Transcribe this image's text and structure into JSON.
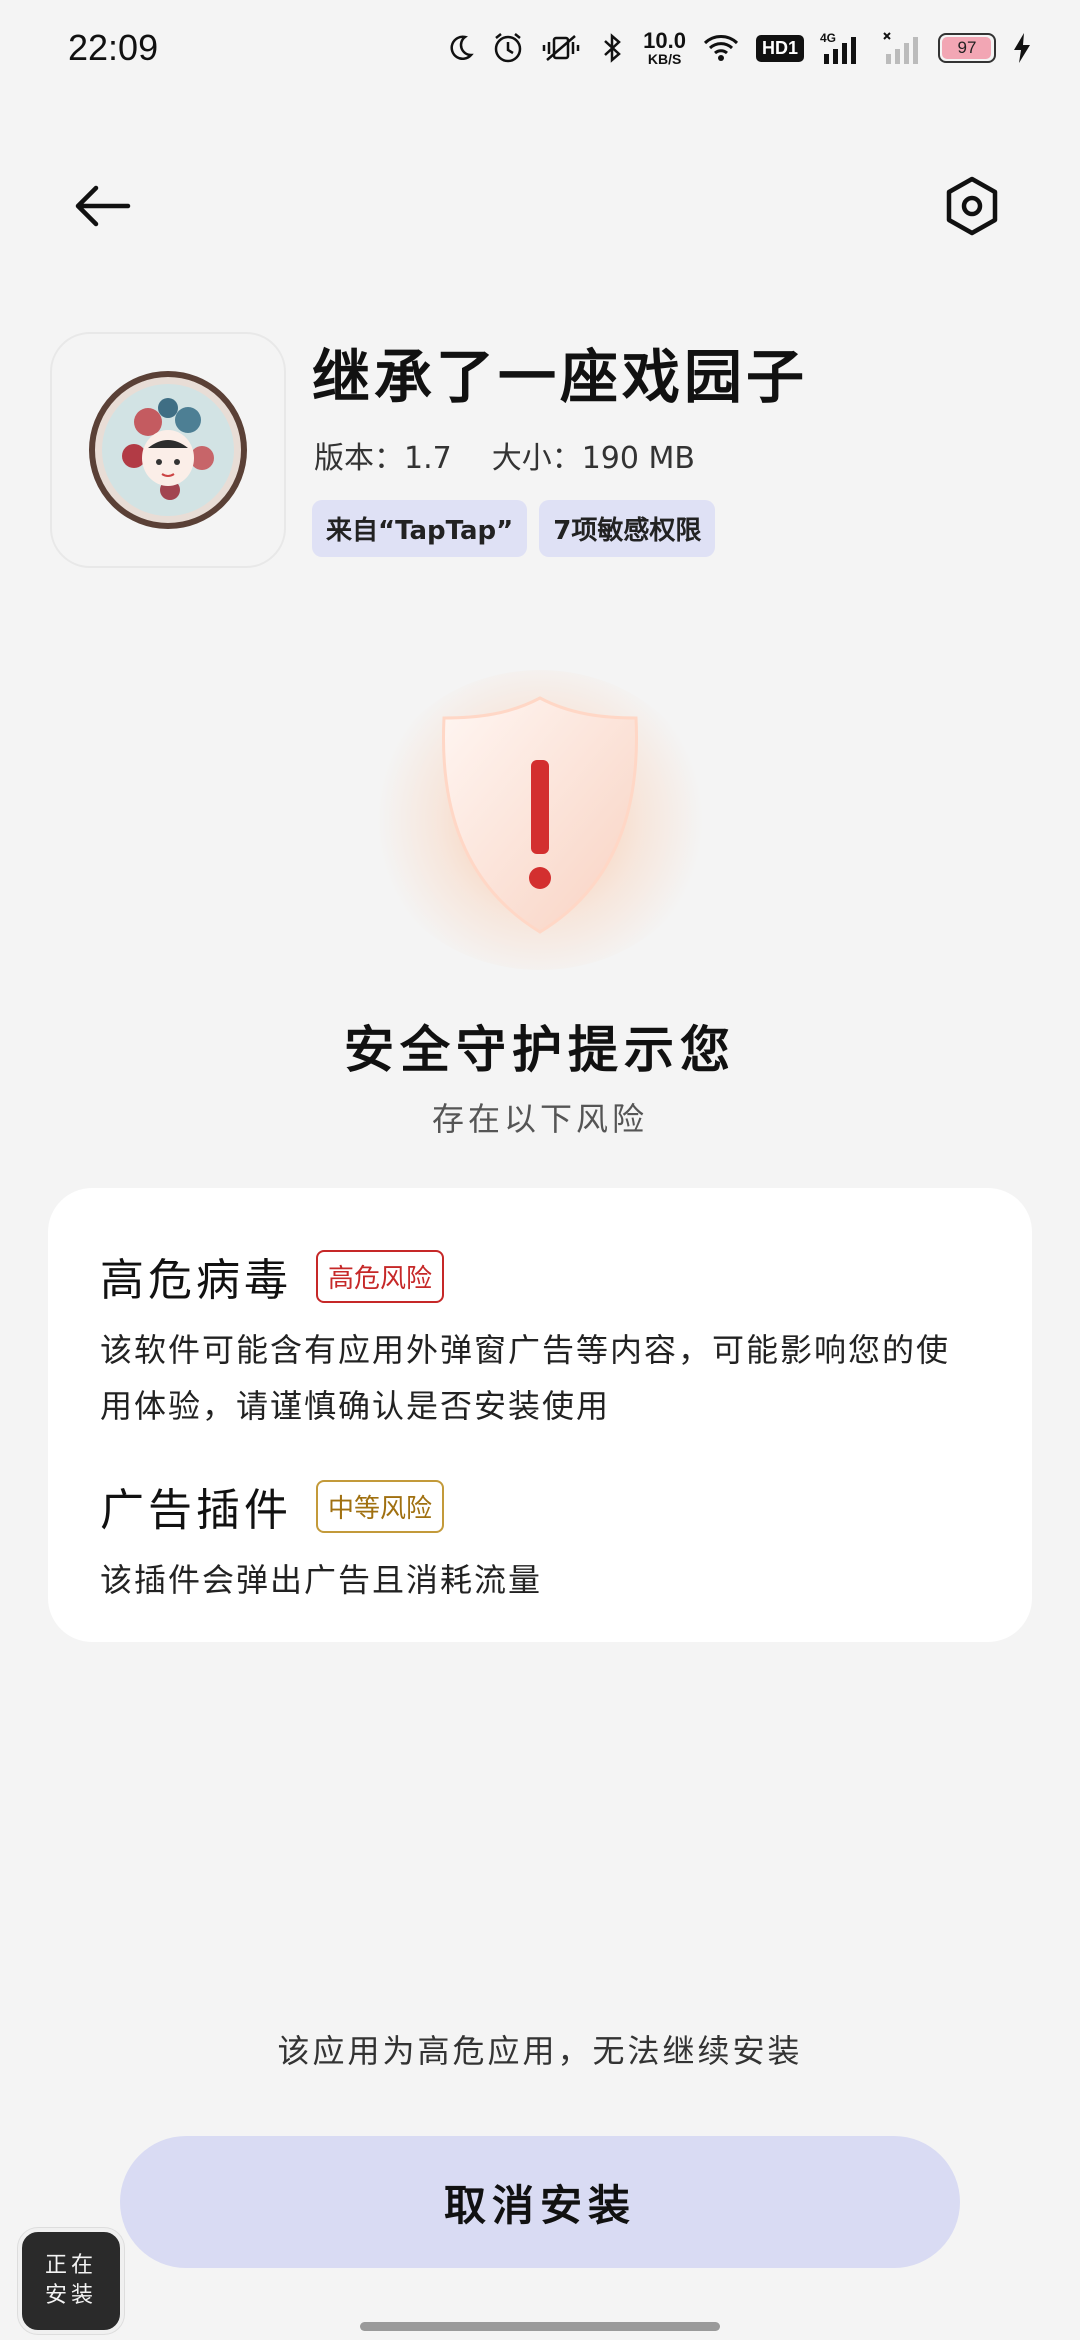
{
  "status_bar": {
    "time": "22:09",
    "net_speed_value": "10.0",
    "net_speed_unit": "KB/S",
    "hd_label": "HD1",
    "signal_label": "4G",
    "battery_level": "97"
  },
  "app": {
    "name": "继承了一座戏园子",
    "version": "版本：1.7",
    "size": "大小：190 MB",
    "tags": [
      "来自“TapTap”",
      "7项敏感权限"
    ]
  },
  "warning": {
    "title": "安全守护提示您",
    "subtitle": "存在以下风险"
  },
  "risks": [
    {
      "name": "高危病毒",
      "badge": "高危风险",
      "description": "该软件可能含有应用外弹窗广告等内容，可能影响您的使用体验，请谨慎确认是否安装使用"
    },
    {
      "name": "广告插件",
      "badge": "中等风险",
      "description": "该插件会弹出广告且消耗流量"
    }
  ],
  "bottom": {
    "note": "该应用为高危应用，无法继续安装",
    "cancel_label": "取消安装",
    "installing_line1": "正在",
    "installing_line2": "安装"
  },
  "colors": {
    "background": "#f4f4f4",
    "tag_bg": "#dfe1f5",
    "button_bg": "#d9dbf3",
    "high_risk": "#c62828",
    "mid_risk": "#c39a3a",
    "shield_mark": "#d32f2f"
  },
  "icons": {
    "back": "arrow-left-icon",
    "settings": "hexagon-gear-icon",
    "shield": "shield-alert-icon"
  }
}
